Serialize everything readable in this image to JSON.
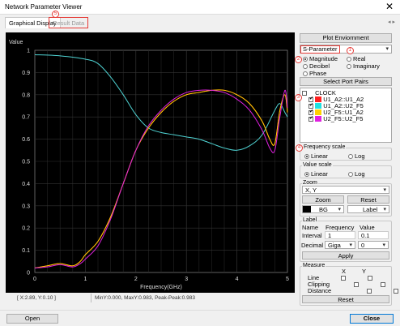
{
  "window": {
    "title": "Network Parameter Viewer",
    "close_glyph": "✕"
  },
  "tabs": [
    {
      "label": "Graphical Display"
    },
    {
      "label": "Result Data"
    }
  ],
  "nav_arrows": "◂ ▸",
  "callouts": [
    "1",
    "2",
    "3",
    "4",
    "5"
  ],
  "chart_data": {
    "type": "line",
    "title": "",
    "xlabel": "Frequency(GHz)",
    "ylabel": "Value",
    "xlim": [
      0,
      5
    ],
    "ylim": [
      0,
      1
    ],
    "x_ticks": [
      "0",
      "1",
      "2",
      "3",
      "4",
      "5"
    ],
    "y_ticks": [
      "0",
      "0.1",
      "0.2",
      "0.3",
      "0.4",
      "0.5",
      "0.6",
      "0.7",
      "0.8",
      "0.9",
      "1"
    ],
    "grid": true,
    "series": [
      {
        "name": "U1_A2::U1_A2",
        "color": "#4fd3d3",
        "x": [
          0,
          0.5,
          1,
          1.25,
          1.5,
          1.75,
          2,
          2.25,
          2.5,
          2.75,
          3,
          3.25,
          3.5,
          3.75,
          4,
          4.25,
          4.5,
          4.75,
          4.85,
          4.95,
          5
        ],
        "y": [
          0.98,
          0.975,
          0.96,
          0.94,
          0.88,
          0.8,
          0.71,
          0.65,
          0.63,
          0.62,
          0.61,
          0.6,
          0.58,
          0.56,
          0.55,
          0.57,
          0.62,
          0.73,
          0.76,
          0.72,
          0.7
        ]
      },
      {
        "name": "U1_A2::U2_F5",
        "color": "#ff2020",
        "x": [
          0,
          0.25,
          0.5,
          0.75,
          0.9,
          1,
          1.25,
          1.5,
          1.75,
          2,
          2.25,
          2.5,
          2.75,
          3,
          3.25,
          3.5,
          3.75,
          4,
          4.25,
          4.5,
          4.65,
          4.75,
          4.85,
          4.95,
          5
        ],
        "y": [
          0.02,
          0.03,
          0.04,
          0.03,
          0.05,
          0.08,
          0.14,
          0.25,
          0.4,
          0.55,
          0.65,
          0.72,
          0.77,
          0.8,
          0.81,
          0.82,
          0.82,
          0.8,
          0.76,
          0.68,
          0.6,
          0.58,
          0.73,
          0.8,
          0.72
        ]
      },
      {
        "name": "U2_F5::U1_A2",
        "color": "#ffd000",
        "x": [
          0,
          0.25,
          0.5,
          0.75,
          0.9,
          1,
          1.25,
          1.5,
          1.75,
          2,
          2.25,
          2.5,
          2.75,
          3,
          3.25,
          3.5,
          3.75,
          4,
          4.25,
          4.5,
          4.65,
          4.75,
          4.85,
          4.95,
          5
        ],
        "y": [
          0.02,
          0.03,
          0.04,
          0.03,
          0.05,
          0.08,
          0.14,
          0.25,
          0.4,
          0.55,
          0.65,
          0.72,
          0.77,
          0.8,
          0.81,
          0.82,
          0.82,
          0.8,
          0.76,
          0.68,
          0.6,
          0.58,
          0.73,
          0.8,
          0.72
        ]
      },
      {
        "name": "U2_F5::U2_F5",
        "color": "#e020e0",
        "x": [
          0,
          0.25,
          0.5,
          0.75,
          0.9,
          1,
          1.25,
          1.5,
          1.75,
          2,
          2.25,
          2.5,
          2.75,
          3,
          3.25,
          3.5,
          3.75,
          4,
          4.25,
          4.5,
          4.65,
          4.75,
          4.85,
          4.95,
          5
        ],
        "y": [
          0.02,
          0.025,
          0.035,
          0.025,
          0.04,
          0.06,
          0.12,
          0.24,
          0.4,
          0.55,
          0.66,
          0.73,
          0.78,
          0.81,
          0.82,
          0.82,
          0.81,
          0.78,
          0.73,
          0.64,
          0.56,
          0.55,
          0.7,
          0.82,
          0.74
        ]
      }
    ]
  },
  "status": {
    "coords": "[ X:2.89, Y:0.10 ]",
    "minmax": "MinY:0.000, MaxY:0.983, Peak-Peak:0.983"
  },
  "side": {
    "plot_env_label": "Plot Enviornment",
    "param_type": "S-Parameter",
    "format_options": [
      "Magnitude",
      "Real",
      "Decibel",
      "Imaginary",
      "Phase"
    ],
    "format_selected": "Magnitude",
    "select_pairs_label": "Select Port Pairs",
    "pairs_header": "CLOCK",
    "pairs": [
      {
        "label": "U1_A2::U1_A2",
        "color": "#ff2020",
        "checked": true
      },
      {
        "label": "U1_A2::U2_F5",
        "color": "#1fe0e0",
        "checked": true
      },
      {
        "label": "U2_F5::U1_A2",
        "color": "#ffd000",
        "checked": true
      },
      {
        "label": "U2_F5::U2_F5",
        "color": "#e020e0",
        "checked": true
      }
    ],
    "freq_scale": {
      "title": "Frequency scale",
      "linear": "Linear",
      "log": "Log",
      "selected": "Linear"
    },
    "value_scale": {
      "title": "Value scale",
      "linear": "Linear",
      "log": "Log",
      "selected": "Linear"
    },
    "zoom": {
      "title": "Zoom",
      "axis": "X, Y",
      "zoom_btn": "Zoom",
      "reset_btn": "Reset",
      "bg_label": "BG",
      "label_label": "Label"
    },
    "label": {
      "title": "Label",
      "name_col": "Name",
      "freq_col": "Frequency",
      "value_col": "Value",
      "interval_label": "Interval",
      "interval_freq": "1",
      "interval_value": "0.1",
      "decimal_label": "Decimal",
      "decimal_unit": "Giga",
      "decimal_value": "0",
      "apply_btn": "Apply"
    },
    "measure": {
      "title": "Measure",
      "x_col": "X",
      "y_col": "Y",
      "rows": [
        "Line",
        "Clipping",
        "Distance"
      ],
      "reset_btn": "Reset"
    }
  },
  "bottom": {
    "open_label": "Open",
    "close_label": "Close"
  }
}
